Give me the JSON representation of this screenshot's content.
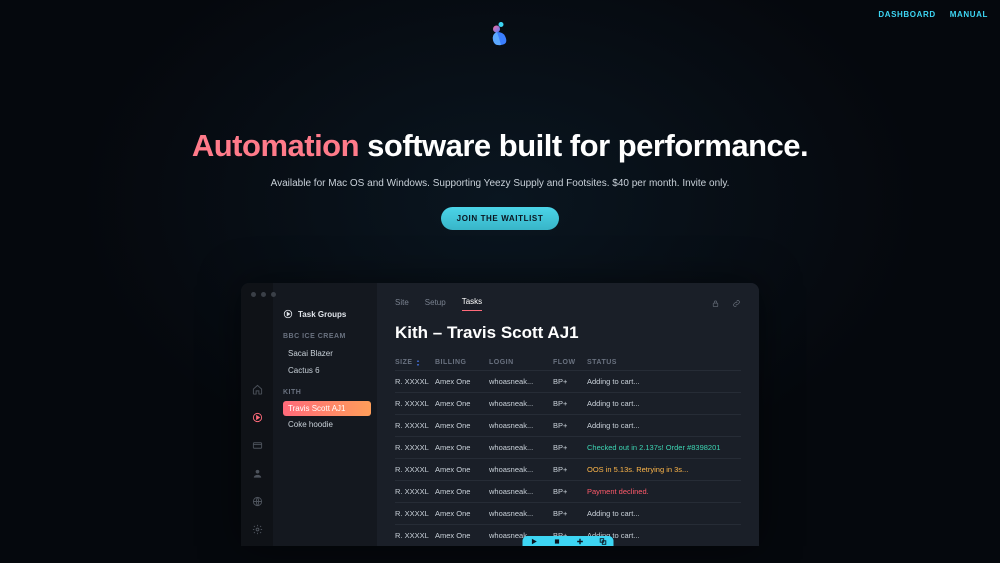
{
  "nav": {
    "dashboard": "DASHBOARD",
    "manual": "MANUAL"
  },
  "hero": {
    "title_accent": "Automation",
    "title_rest": " software built for performance.",
    "subtitle": "Available for Mac OS and Windows. Supporting Yeezy Supply and Footsites. $40 per month. Invite only.",
    "cta": "JOIN THE WAITLIST"
  },
  "app": {
    "sidebar_title": "Task Groups",
    "groups": [
      {
        "label": "BBC ICE CREAM",
        "items": [
          "Sacai Blazer",
          "Cactus 6"
        ]
      },
      {
        "label": "KITH",
        "items": [
          "Travis Scott AJ1",
          "Coke hoodie"
        ],
        "active_index": 0
      }
    ],
    "tabs": {
      "site": "Site",
      "setup": "Setup",
      "tasks": "Tasks"
    },
    "title": "Kith – Travis Scott AJ1",
    "columns": {
      "size": "SIZE",
      "billing": "BILLING",
      "login": "LOGIN",
      "flow": "FLOW",
      "status": "STATUS"
    },
    "rows": [
      {
        "size": "R. XXXXL",
        "billing": "Amex One",
        "login": "whoasneak...",
        "flow": "BP+",
        "status": "Adding to cart...",
        "status_class": "default"
      },
      {
        "size": "R. XXXXL",
        "billing": "Amex One",
        "login": "whoasneak...",
        "flow": "BP+",
        "status": "Adding to cart...",
        "status_class": "default"
      },
      {
        "size": "R. XXXXL",
        "billing": "Amex One",
        "login": "whoasneak...",
        "flow": "BP+",
        "status": "Adding to cart...",
        "status_class": "default"
      },
      {
        "size": "R. XXXXL",
        "billing": "Amex One",
        "login": "whoasneak...",
        "flow": "BP+",
        "status": "Checked out in 2.137s! Order #8398201",
        "status_class": "success"
      },
      {
        "size": "R. XXXXL",
        "billing": "Amex One",
        "login": "whoasneak...",
        "flow": "BP+",
        "status": "OOS in 5.13s. Retrying in 3s...",
        "status_class": "warning"
      },
      {
        "size": "R. XXXXL",
        "billing": "Amex One",
        "login": "whoasneak...",
        "flow": "BP+",
        "status": "Payment declined.",
        "status_class": "error"
      },
      {
        "size": "R. XXXXL",
        "billing": "Amex One",
        "login": "whoasneak...",
        "flow": "BP+",
        "status": "Adding to cart...",
        "status_class": "default"
      },
      {
        "size": "R. XXXXL",
        "billing": "Amex One",
        "login": "whoasneak...",
        "flow": "BP+",
        "status": "Adding to cart...",
        "status_class": "default"
      }
    ]
  }
}
